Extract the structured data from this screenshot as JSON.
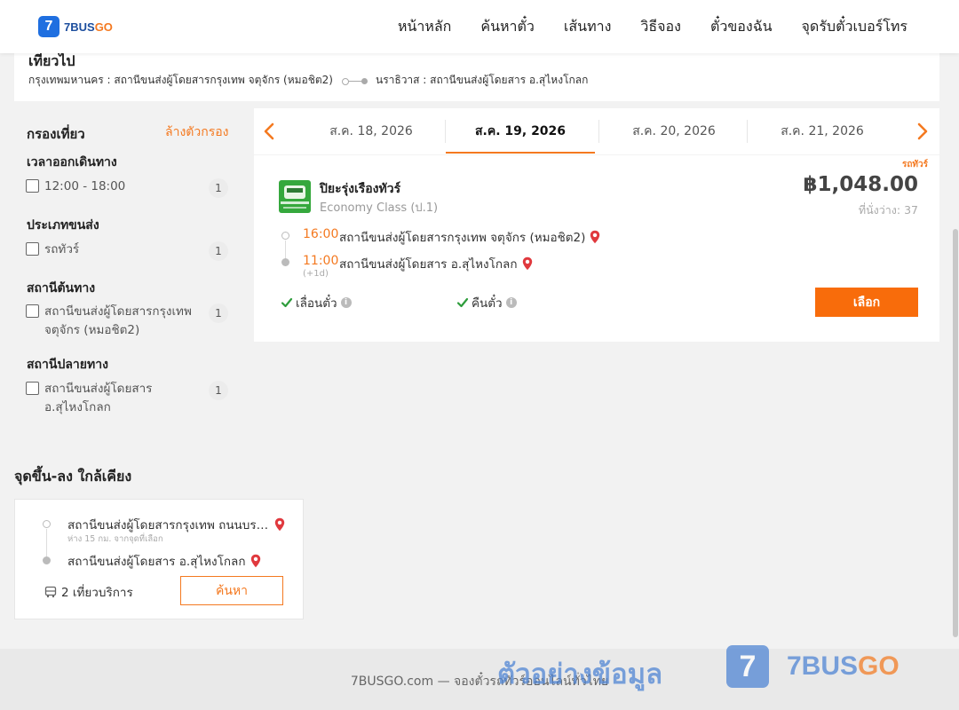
{
  "header": {
    "logo_mark": "7",
    "logo_text": "7BUS",
    "logo_text_accent": "GO",
    "nav": [
      "หน้าหลัก",
      "ค้นหาตั๋ว",
      "เส้นทาง",
      "วิธีจอง",
      "ตั๋วของฉัน",
      "จุดรับตั๋วเบอร์โทร"
    ]
  },
  "route": {
    "title": "เที่ยวไป",
    "origin": "กรุงเทพมหานคร : สถานีขนส่งผู้โดยสารกรุงเทพ จตุจักร (หมอชิต2)",
    "destination": "นราธิวาส : สถานีขนส่งผู้โดยสาร อ.สุไหงโกลก"
  },
  "filter": {
    "title": "กรองเที่ยว",
    "clear": "ล้างตัวกรอง",
    "sections": [
      {
        "title": "เวลาออกเดินทาง",
        "option": "12:00 - 18:00",
        "count": "1"
      },
      {
        "title": "ประเภทขนส่ง",
        "option": "รถทัวร์",
        "count": "1"
      },
      {
        "title": "สถานีต้นทาง",
        "option": "สถานีขนส่งผู้โดยสารกรุงเทพ จตุจักร (หมอชิต2)",
        "count": "1"
      },
      {
        "title": "สถานีปลายทาง",
        "option": "สถานีขนส่งผู้โดยสาร อ.สุไหงโกลก",
        "count": "1"
      }
    ]
  },
  "dates": {
    "tabs": [
      "ส.ค. 18, 2026",
      "ส.ค. 19, 2026",
      "ส.ค. 20, 2026",
      "ส.ค. 21, 2026"
    ],
    "active_index": 1
  },
  "result": {
    "tag": "รถทัวร์",
    "operator": "ปิยะรุ่งเรืองทัวร์",
    "class": "Economy Class (ป.1)",
    "price": "฿1,048.00",
    "seats": "ที่นั่งว่าง: 37",
    "depart_time": "16:00",
    "depart_station": "สถานีขนส่งผู้โดยสารกรุงเทพ จตุจักร (หมอชิต2)",
    "arrive_time": "11:00",
    "arrive_station": "สถานีขนส่งผู้โดยสาร อ.สุไหงโกลก",
    "day_offset": "(+1d)",
    "feature_reschedule": "เลื่อนตั๋ว",
    "feature_refund": "คืนตั๋ว",
    "select_label": "เลือก"
  },
  "nearby": {
    "title": "จุดขึ้น-ลง ใกล้เคียง",
    "from_station": "สถานีขนส่งผู้โดยสารกรุงเทพ ถนนบรม...",
    "distance": "ห่าง 15 กม. จากจุดที่เลือก",
    "to_station": "สถานีขนส่งผู้โดยสาร อ.สุไหงโกลก",
    "trips": "2 เที่ยวบริการ",
    "search_label": "ค้นหา"
  },
  "footer": {
    "text": "7BUSGO.com — จองตั๋วรถทัวร์ออนไลน์ทั่วไทย",
    "watermark": "ตัวอย่างข้อมูล",
    "watermark_mark": "7",
    "watermark_brand": "7BUS",
    "watermark_brand_accent": "GO"
  },
  "colors": {
    "accent": "#f47920",
    "button": "#f86c0b",
    "brand_blue": "#1f6fe0",
    "pin": "#e0393e",
    "check": "#2e9d3c"
  }
}
